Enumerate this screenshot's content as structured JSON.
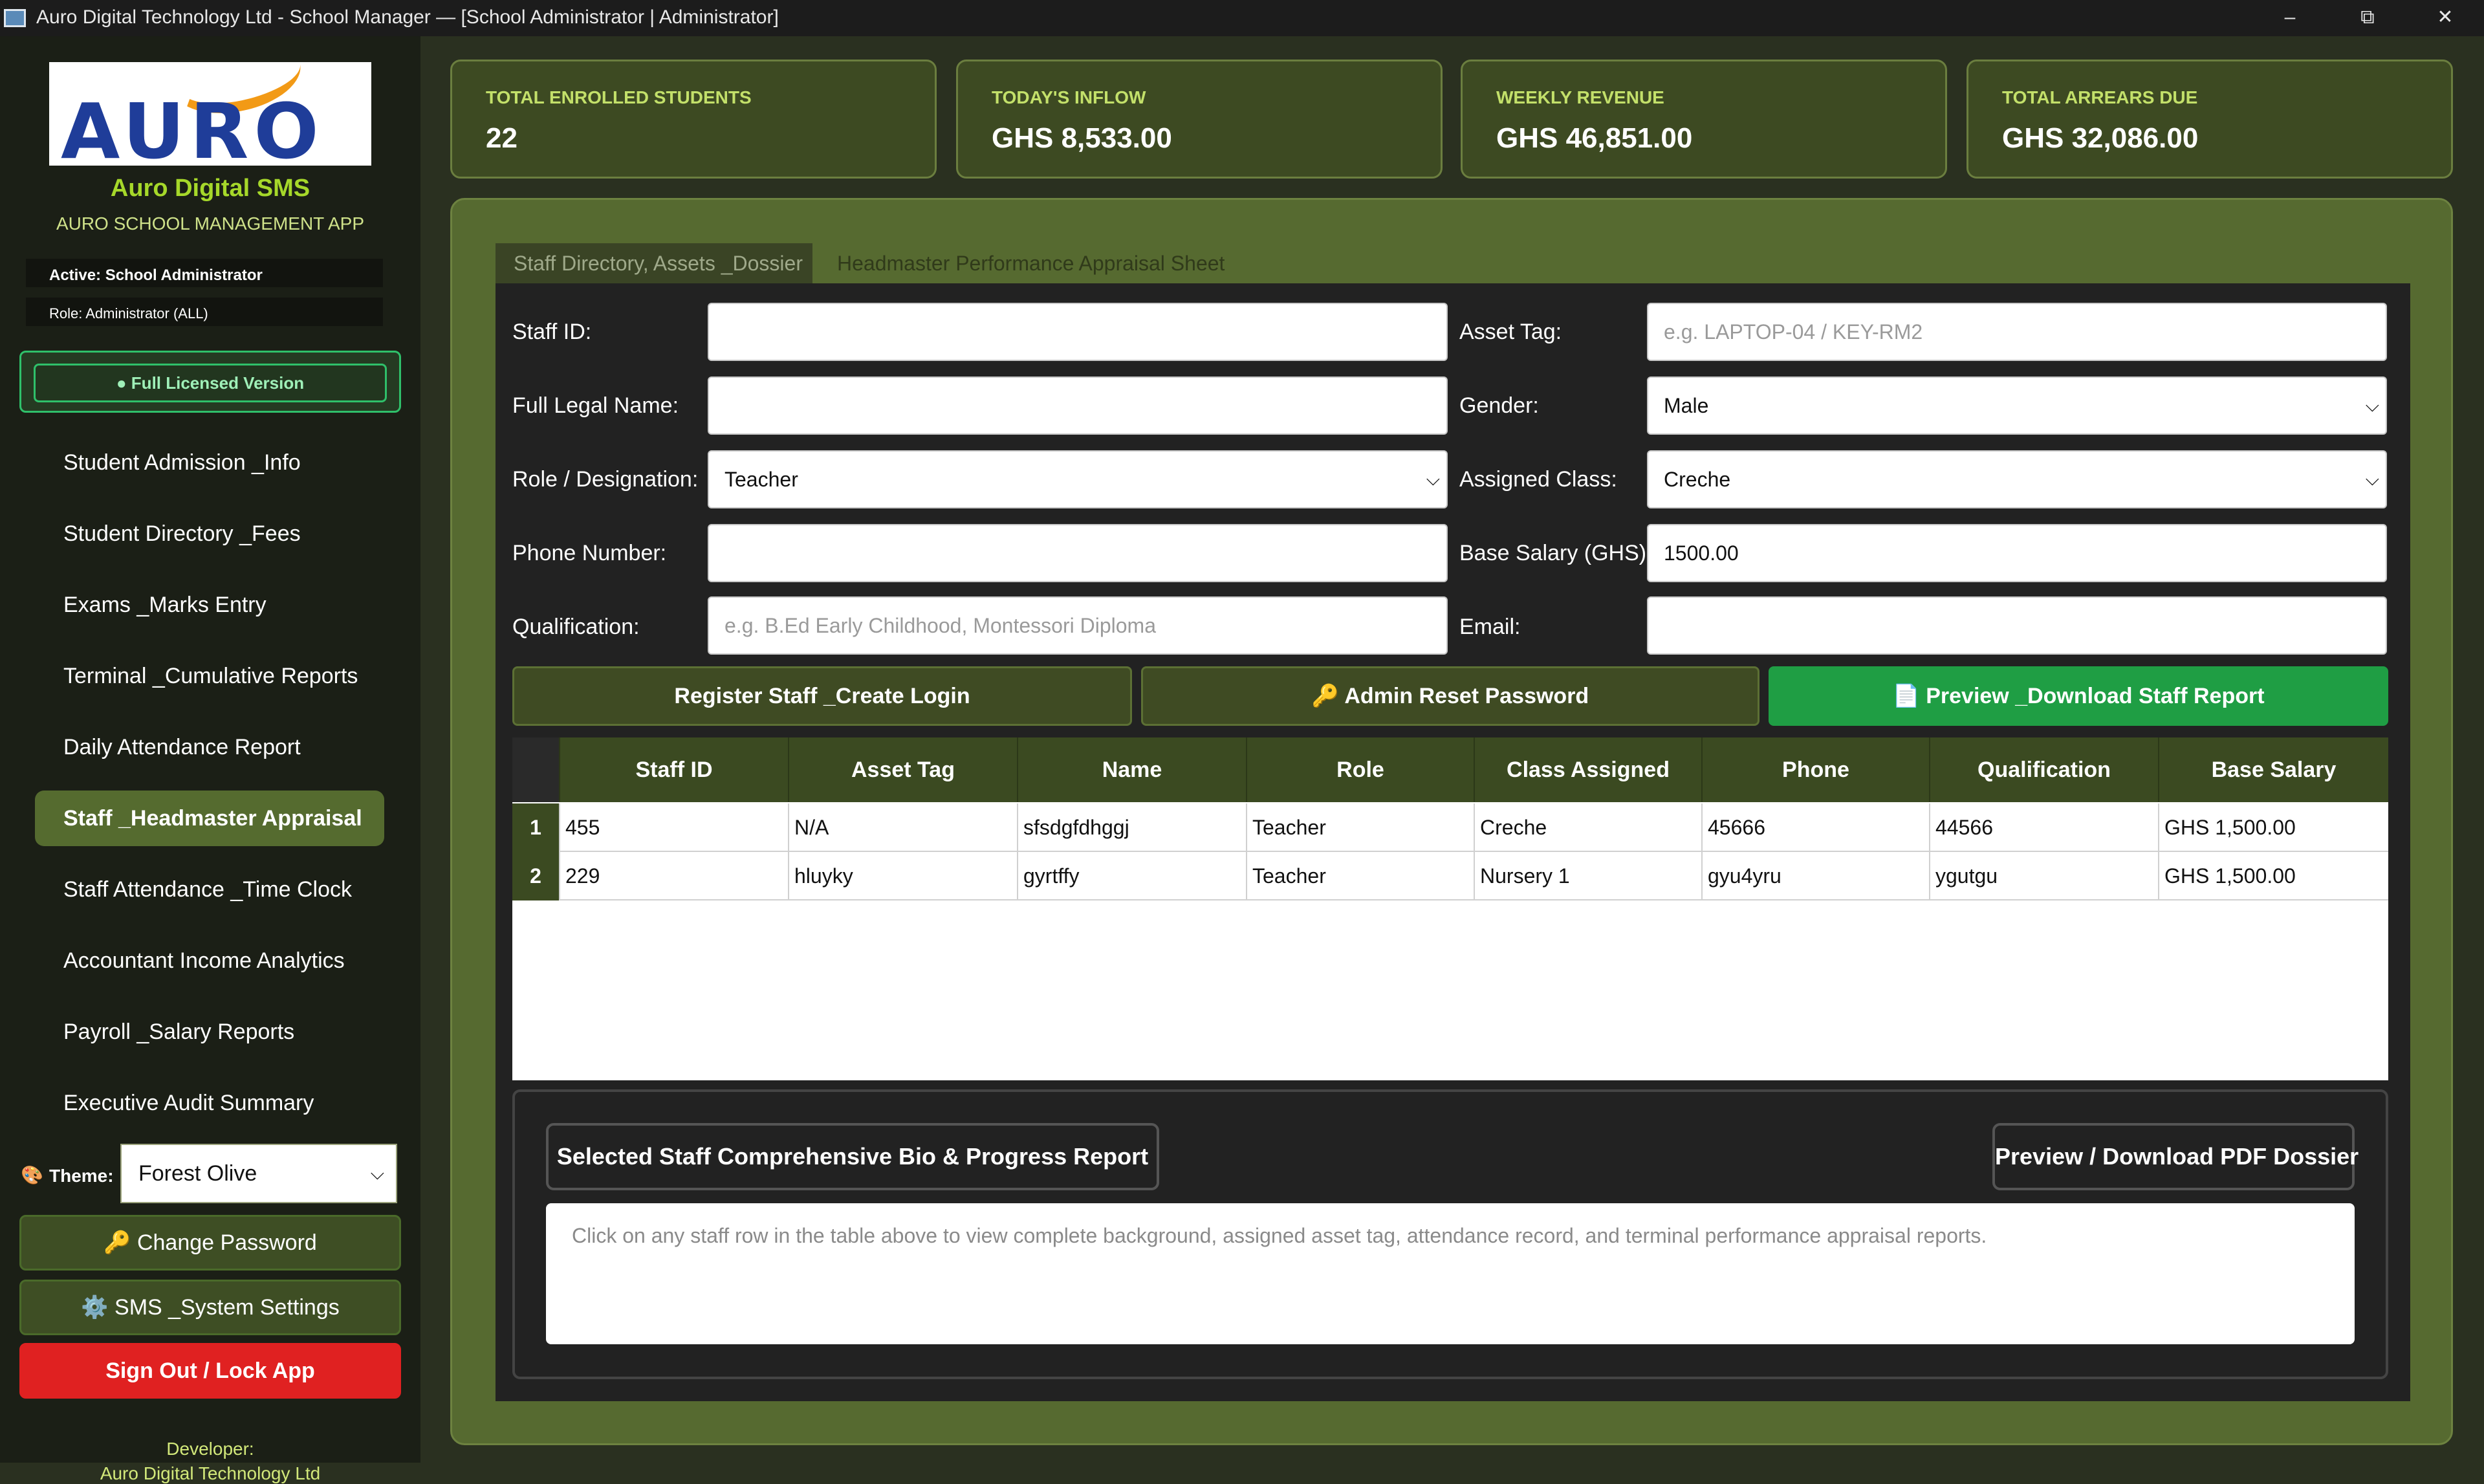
{
  "window": {
    "title": "Auro Digital Technology Ltd - School Manager — [School Administrator | Administrator]",
    "minimize": "–",
    "maximize": "⧉",
    "close": "✕"
  },
  "sidebar": {
    "logo_text": "AURO",
    "app_name": "Auro Digital SMS",
    "app_subtitle": "AURO SCHOOL MANAGEMENT APP",
    "active_user": "Active: School Administrator",
    "role": "Role: Administrator (ALL)",
    "license": "● Full Licensed Version",
    "nav": [
      {
        "label": "Student Admission _Info"
      },
      {
        "label": "Student Directory _Fees"
      },
      {
        "label": "Exams _Marks Entry"
      },
      {
        "label": "Terminal _Cumulative Reports"
      },
      {
        "label": "Daily Attendance Report"
      },
      {
        "label": "Staff _Headmaster Appraisal"
      },
      {
        "label": "Staff Attendance _Time Clock"
      },
      {
        "label": "Accountant Income Analytics"
      },
      {
        "label": "Payroll _Salary Reports"
      },
      {
        "label": "Executive Audit Summary"
      }
    ],
    "theme_label": "Theme:",
    "theme_value": "Forest Olive",
    "change_password": "🔑 Change Password",
    "system_settings": "⚙️ SMS _System Settings",
    "sign_out": "Sign Out / Lock App",
    "developer_label": "Developer:",
    "developer_name": "Auro Digital Technology Ltd"
  },
  "stats": [
    {
      "label": "TOTAL ENROLLED STUDENTS",
      "value": "22"
    },
    {
      "label": "TODAY'S INFLOW",
      "value": "GHS 8,533.00"
    },
    {
      "label": "WEEKLY REVENUE",
      "value": "GHS 46,851.00"
    },
    {
      "label": "TOTAL ARREARS DUE",
      "value": "GHS 32,086.00"
    }
  ],
  "tabs": {
    "staff": "Staff Directory, Assets _Dossier",
    "appraisal": "Headmaster Performance Appraisal Sheet"
  },
  "form": {
    "staff_id_label": "Staff ID:",
    "staff_id_value": "",
    "asset_tag_label": "Asset Tag:",
    "asset_tag_placeholder": "e.g. LAPTOP-04 / KEY-RM2",
    "full_name_label": "Full Legal Name:",
    "full_name_value": "",
    "gender_label": "Gender:",
    "gender_value": "Male",
    "role_label": "Role / Designation:",
    "role_value": "Teacher",
    "class_label": "Assigned Class:",
    "class_value": "Creche",
    "phone_label": "Phone Number:",
    "phone_value": "",
    "salary_label": "Base Salary (GHS):",
    "salary_value": "1500.00",
    "qualification_label": "Qualification:",
    "qualification_placeholder": "e.g. B.Ed Early Childhood, Montessori Diploma",
    "email_label": "Email:",
    "email_value": ""
  },
  "actions": {
    "register": "Register Staff _Create Login",
    "reset_password": "🔑 Admin Reset Password",
    "preview_report": "📄 Preview _Download Staff Report"
  },
  "table": {
    "columns": [
      "Staff ID",
      "Asset Tag",
      "Name",
      "Role",
      "Class Assigned",
      "Phone",
      "Qualification",
      "Base Salary"
    ],
    "rows": [
      {
        "num": "1",
        "cells": [
          "455",
          "N/A",
          "sfsdgfdhggj",
          "Teacher",
          "Creche",
          "45666",
          "44566",
          "GHS 1,500.00"
        ]
      },
      {
        "num": "2",
        "cells": [
          "229",
          "hluyky",
          "gyrtffy",
          "Teacher",
          "Nursery 1",
          "gyu4yru",
          "ygutgu",
          "GHS 1,500.00"
        ]
      }
    ]
  },
  "bio": {
    "title": "Selected Staff Comprehensive Bio & Progress Report",
    "pdf_button": "Preview / Download PDF Dossier",
    "placeholder": "Click on any staff row in the table above to view complete background, assigned asset tag, attendance record, and terminal performance appraisal reports."
  },
  "colors": {
    "sidebar_bg": "#1b1f16",
    "main_bg": "#2a3020",
    "accent_green": "#556b2f",
    "stat_label": "#c3e06a",
    "brand_lime": "#a6d82a",
    "preview_button": "#1f9e44",
    "sign_out": "#e02121"
  }
}
